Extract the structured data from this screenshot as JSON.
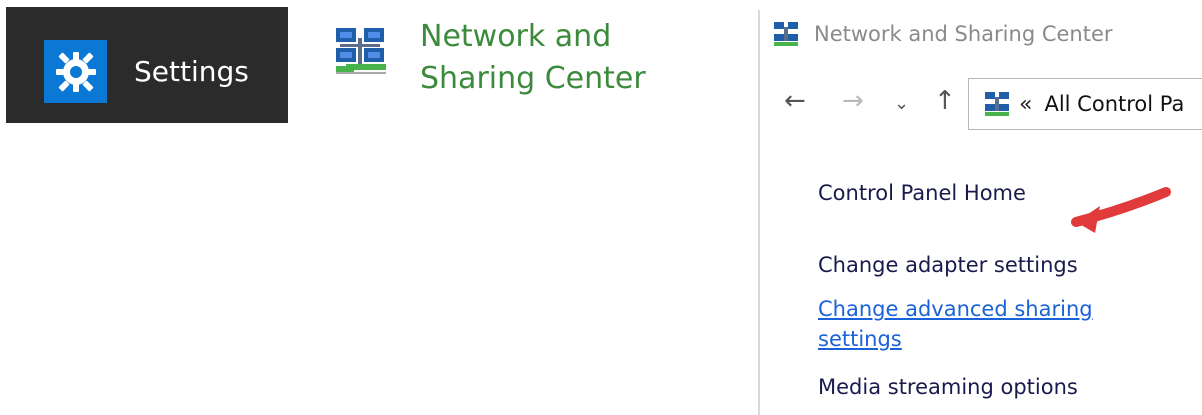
{
  "settings_tile": {
    "icon": "gear-icon",
    "label": "Settings",
    "colors": {
      "background": "#2b2b2b",
      "icon_background": "#0a78d4"
    }
  },
  "network_tile": {
    "icon": "network-icon",
    "label": "Network and Sharing Center",
    "label_color": "#3c8a3c"
  },
  "control_panel": {
    "title": "Network and Sharing Center",
    "nav": {
      "back": "←",
      "forward": "→",
      "recent": "⌄",
      "up": "↑"
    },
    "address": {
      "chevron": "«",
      "text": "All Control Pa"
    },
    "sidebar": {
      "home": "Control Panel Home",
      "adapter": "Change adapter settings",
      "advanced": "Change advanced sharing settings",
      "media": "Media streaming options"
    },
    "annotation": {
      "icon": "red-arrow",
      "color": "#e03a3a"
    }
  }
}
